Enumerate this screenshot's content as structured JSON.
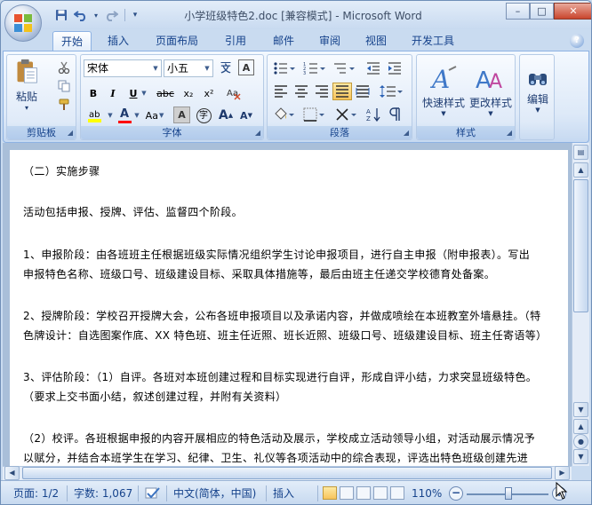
{
  "window": {
    "title": "小学班级特色2.doc [兼容模式] - Microsoft Word",
    "minimize": "–",
    "maximize": "□",
    "close": "✕"
  },
  "quick_access": {
    "save": "💾",
    "undo": "↶",
    "redo": "↷",
    "more": "▾"
  },
  "tabs": [
    "开始",
    "插入",
    "页面布局",
    "引用",
    "邮件",
    "审阅",
    "视图",
    "开发工具"
  ],
  "help_label": "?",
  "ribbon": {
    "clipboard": {
      "label": "剪贴板",
      "paste": "粘贴",
      "paste_arrow": "▾"
    },
    "font": {
      "label": "字体",
      "font_name": "宋体",
      "font_size": "小五",
      "bold": "B",
      "italic": "I",
      "underline": "U",
      "strikethrough": "abc",
      "subscript": "x₂",
      "superscript": "x²",
      "change_case": "Aa",
      "grow": "A",
      "shrink": "A",
      "font_color": "A",
      "char_border": "A",
      "char_shading": "A",
      "phonetic": "文",
      "enclose": "字"
    },
    "paragraph": {
      "label": "段落"
    },
    "styles": {
      "label": "样式",
      "quick_styles": "快速样式",
      "change_styles": "更改样式"
    },
    "editing": {
      "label": "编辑"
    }
  },
  "document": {
    "paragraphs": [
      "（二）实施步骤",
      "活动包括申报、授牌、评估、监督四个阶段。",
      "1、申报阶段：由各班班主任根据班级实际情况组织学生讨论申报项目，进行自主申报（附申报表）。写出",
      "申报特色名称、班级口号、班级建设目标、采取具体措施等，最后由班主任递交学校德育处备案。",
      "2、授牌阶段：学校召开授牌大会，公布各班申报项目以及承诺内容，并做成喷绘在本班教室外墙悬挂。（特",
      "色牌设计：自选图案作底、XX 特色班、班主任近照、班长近照、班级口号、班级建设目标、班主任寄语等）",
      "3、评估阶段：（1）自评。各班对本班创建过程和目标实现进行自评，形成自评小结，力求突显班级特色。",
      "（要求上交书面小结，叙述创建过程，并附有关资料）",
      "（2）校评。各班根据申报的内容开展相应的特色活动及展示，学校成立活动领导小组，对活动展示情况予",
      "以赋分，并结合本班学生在学习、纪律、卫生、礼仪等各项活动中的综合表现，评选出特色班级创建先进"
    ]
  },
  "status_bar": {
    "page": "页面: 1/2",
    "words": "字数: 1,067",
    "language": "中文(简体，中国)",
    "mode": "插入",
    "zoom": "110%",
    "zoom_minus": "−",
    "zoom_plus": "+"
  },
  "colors": {
    "accent": "#15428b",
    "ribbon_bg": "#dde9f8",
    "highlight": "#ffff00",
    "font_color_bar": "#ff0000",
    "close_btn": "#c9452d"
  }
}
